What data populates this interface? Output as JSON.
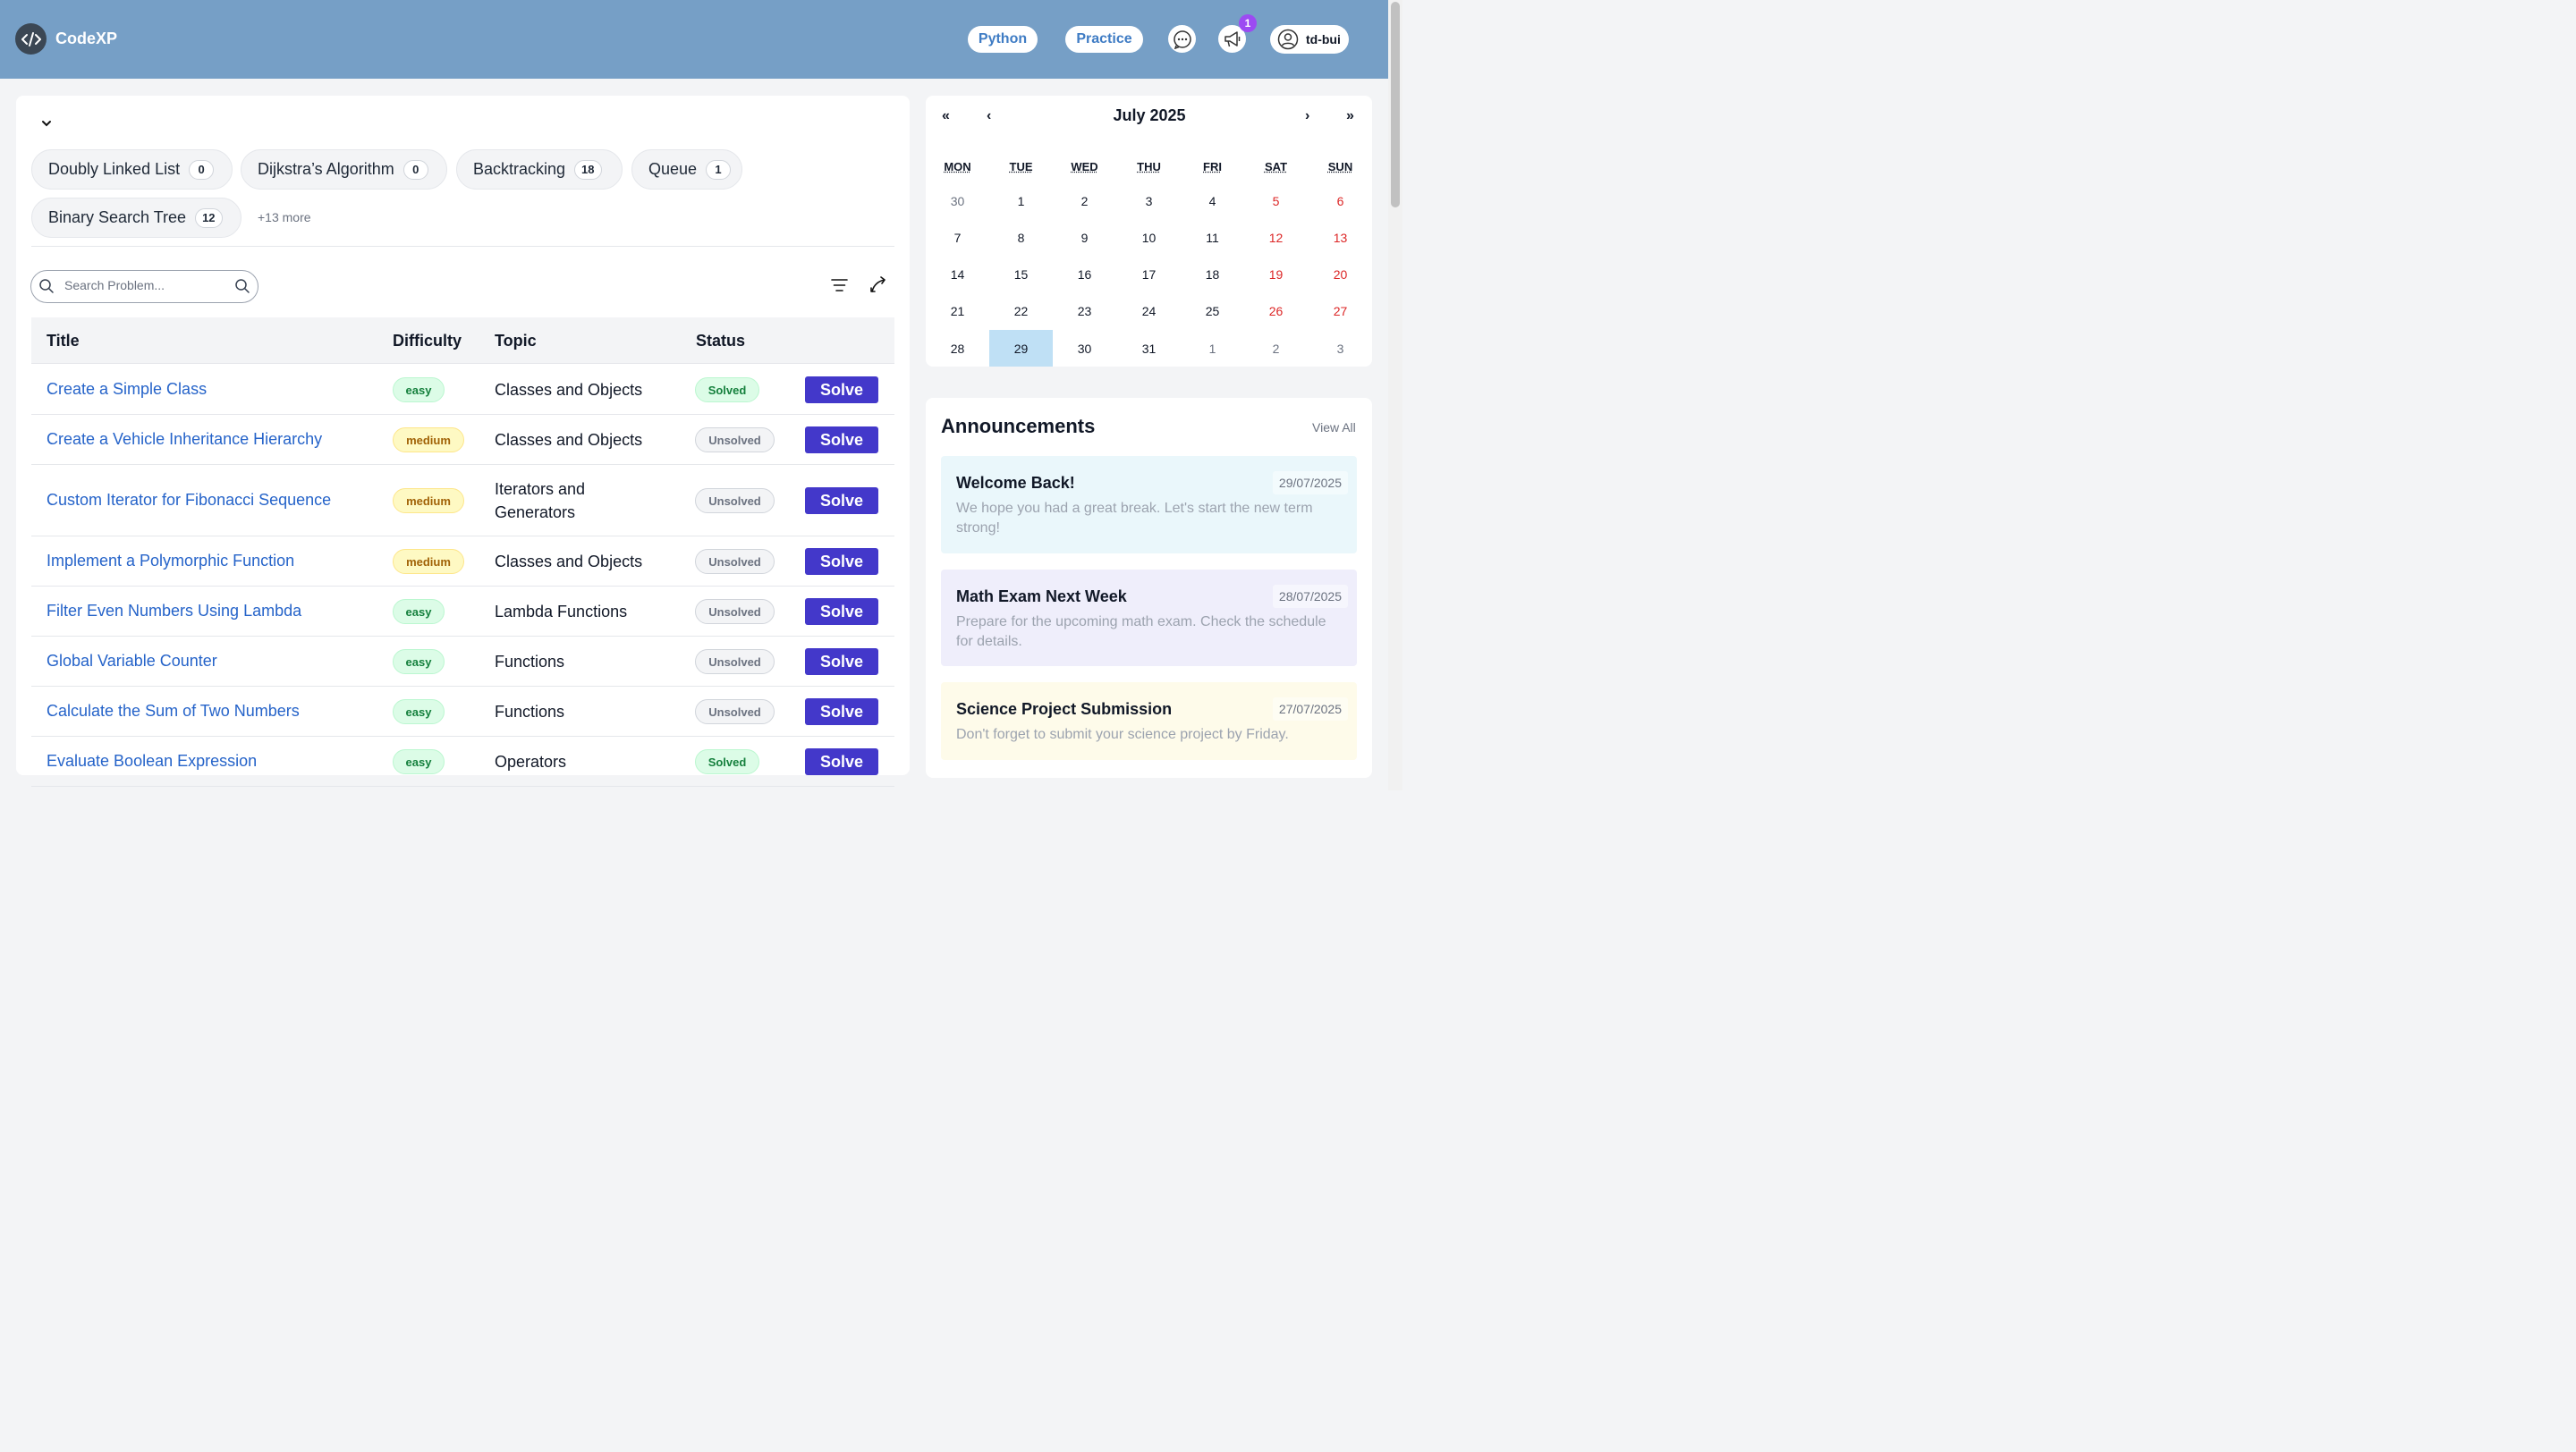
{
  "header": {
    "app_name": "CodeXP",
    "language_label": "Python",
    "practice_label": "Practice",
    "notification_count": "1",
    "username": "td-bui"
  },
  "tags": {
    "items": [
      {
        "label": "Doubly Linked List",
        "count": "0"
      },
      {
        "label": "Dijkstra’s Algorithm",
        "count": "0"
      },
      {
        "label": "Backtracking",
        "count": "18"
      },
      {
        "label": "Queue",
        "count": "1"
      },
      {
        "label": "Binary Search Tree",
        "count": "12"
      }
    ],
    "more_label": "+13 more"
  },
  "search": {
    "placeholder": "Search Problem..."
  },
  "table": {
    "headers": {
      "title": "Title",
      "difficulty": "Difficulty",
      "topic": "Topic",
      "status": "Status"
    },
    "solve_label": "Solve",
    "rows": [
      {
        "title": "Create a Simple Class",
        "difficulty": "easy",
        "topic": "Classes and Objects",
        "status": "Solved"
      },
      {
        "title": "Create a Vehicle Inheritance Hierarchy",
        "difficulty": "medium",
        "topic": "Classes and Objects",
        "status": "Unsolved"
      },
      {
        "title": "Custom Iterator for Fibonacci Sequence",
        "difficulty": "medium",
        "topic_line1": "Iterators and",
        "topic_line2": "Generators",
        "status": "Unsolved"
      },
      {
        "title": "Implement a Polymorphic Function",
        "difficulty": "medium",
        "topic": "Classes and Objects",
        "status": "Unsolved"
      },
      {
        "title": "Filter Even Numbers Using Lambda",
        "difficulty": "easy",
        "topic": "Lambda Functions",
        "status": "Unsolved"
      },
      {
        "title": "Global Variable Counter",
        "difficulty": "easy",
        "topic": "Functions",
        "status": "Unsolved"
      },
      {
        "title": "Calculate the Sum of Two Numbers",
        "difficulty": "easy",
        "topic": "Functions",
        "status": "Unsolved"
      },
      {
        "title": "Evaluate Boolean Expression",
        "difficulty": "easy",
        "topic": "Operators",
        "status": "Solved"
      }
    ]
  },
  "calendar": {
    "prev_year": "«",
    "prev_month": "‹",
    "next_month": "›",
    "next_year": "»",
    "month_label": "July 2025",
    "weekdays": [
      "MON",
      "TUE",
      "WED",
      "THU",
      "FRI",
      "SAT",
      "SUN"
    ],
    "weeks": [
      [
        "30",
        "1",
        "2",
        "3",
        "4",
        "5",
        "6"
      ],
      [
        "7",
        "8",
        "9",
        "10",
        "11",
        "12",
        "13"
      ],
      [
        "14",
        "15",
        "16",
        "17",
        "18",
        "19",
        "20"
      ],
      [
        "21",
        "22",
        "23",
        "24",
        "25",
        "26",
        "27"
      ],
      [
        "28",
        "29",
        "30",
        "31",
        "1",
        "2",
        "3"
      ]
    ],
    "selected_day": "29"
  },
  "announcements": {
    "heading": "Announcements",
    "view_all": "View All",
    "items": [
      {
        "title": "Welcome Back!",
        "date": "29/07/2025",
        "body": "We hope you had a great break. Let's start the new term strong!",
        "color": "#eaf7fb"
      },
      {
        "title": "Math Exam Next Week",
        "date": "28/07/2025",
        "body": "Prepare for the upcoming math exam. Check the schedule for details.",
        "color": "#efeefb"
      },
      {
        "title": "Science Project Submission",
        "date": "27/07/2025",
        "body": "Don't forget to submit your science project by Friday.",
        "color": "#fefbea"
      }
    ]
  },
  "colors": {
    "header_bg": "#769fc6",
    "solve_button": "#4338ca",
    "link": "#2563c9",
    "weekend": "#dc2626",
    "today": "#bfe0f5"
  }
}
